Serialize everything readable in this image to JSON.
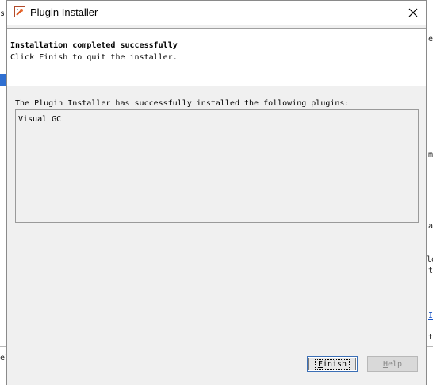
{
  "background": {
    "fragments": [
      "s",
      "ea",
      "m",
      "a",
      "lo",
      "t",
      "I",
      "t",
      "el"
    ]
  },
  "dialog": {
    "title": "Plugin Installer",
    "icon": "plugin-installer-icon",
    "header": {
      "title": "Installation completed successfully",
      "subtitle": "Click Finish to quit the installer."
    },
    "message": "The Plugin Installer has successfully installed the following plugins:",
    "plugins": [
      "Visual GC"
    ],
    "buttons": {
      "finish_mnemonic": "F",
      "finish_rest": "inish",
      "help_mnemonic": "H",
      "help_rest": "elp"
    }
  },
  "colors": {
    "accent": "#3b6fb6",
    "dialog_bg": "#f0f0f0",
    "header_bg": "#ffffff",
    "disabled_text": "#8a8a8a"
  }
}
